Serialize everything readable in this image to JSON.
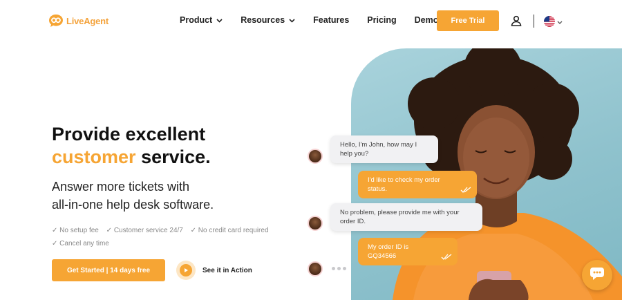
{
  "brand": {
    "name": "LiveAgent",
    "color": "#f6a534"
  },
  "nav": {
    "items": [
      {
        "label": "Product",
        "dropdown": true
      },
      {
        "label": "Resources",
        "dropdown": true
      },
      {
        "label": "Features",
        "dropdown": false
      },
      {
        "label": "Pricing",
        "dropdown": false
      },
      {
        "label": "Demo",
        "dropdown": false
      }
    ],
    "trial_label": "Free Trial",
    "icons": {
      "account": "user-icon",
      "language": "us-flag-icon"
    }
  },
  "hero": {
    "title_line1": "Provide excellent",
    "title_accent": "customer",
    "title_rest": "service.",
    "subtitle_line1": "Answer more tickets with",
    "subtitle_line2": "all-in-one help desk software.",
    "features": [
      "✓ No setup fee",
      "✓ Customer service 24/7",
      "✓ No credit card required",
      "✓ Cancel any time"
    ],
    "cta_primary": "Get Started | 14 days free",
    "cta_secondary": "See it in Action"
  },
  "chat": {
    "messages": [
      {
        "from": "agent",
        "text": "Hello, I'm John, how may I help you?"
      },
      {
        "from": "customer",
        "text": "I'd like to check my order status."
      },
      {
        "from": "agent",
        "text": "No problem, please provide me with your order ID."
      },
      {
        "from": "customer",
        "text": "My order ID is GQ34566"
      }
    ]
  }
}
